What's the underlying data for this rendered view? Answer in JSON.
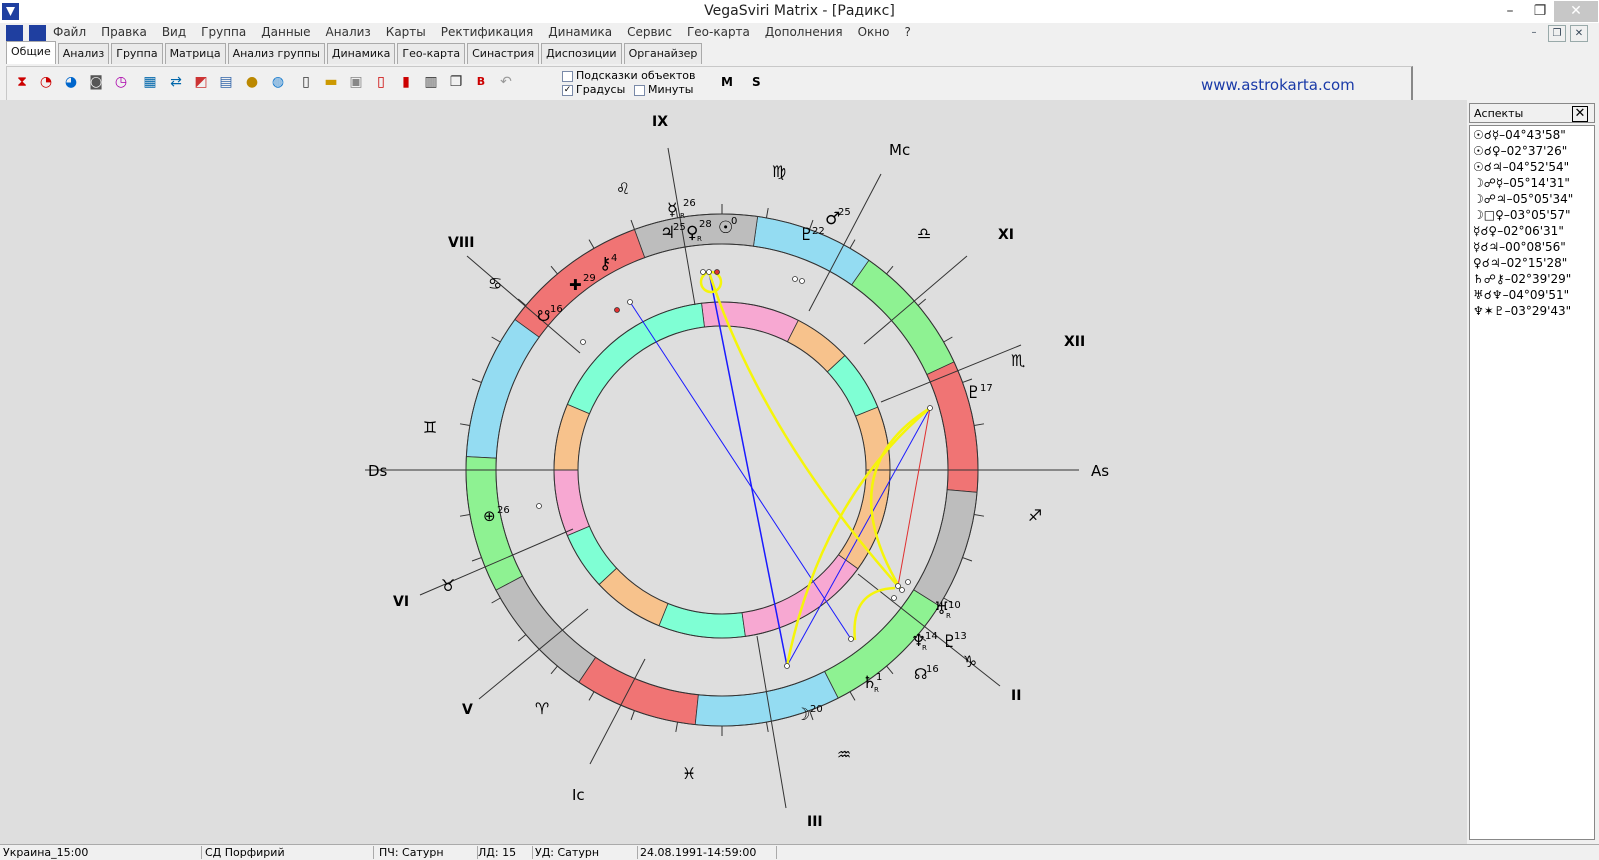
{
  "window": {
    "title": "VegaSviri Matrix - [Радикс]",
    "min_glyph": "–",
    "max_glyph": "❐",
    "close_glyph": "✕"
  },
  "menu": [
    "Файл",
    "Правка",
    "Вид",
    "Группа",
    "Данные",
    "Анализ",
    "Карты",
    "Ректификация",
    "Динамика",
    "Сервис",
    "Гео-карта",
    "Дополнения",
    "Окно",
    "?"
  ],
  "tabs": [
    "Общие",
    "Анализ",
    "Группа",
    "Матрица",
    "Анализ группы",
    "Динамика",
    "Гео-карта",
    "Синастрия",
    "Диспозиции",
    "Органайзер"
  ],
  "toolbar": {
    "hints_label": "Подсказки объектов",
    "degrees_label": "Градусы",
    "minutes_label": "Минуты",
    "m_label": "M",
    "s_label": "S",
    "website": "www.astrokarta.com"
  },
  "chart": {
    "angles": {
      "as": "As",
      "ds": "Ds",
      "mc": "Mc",
      "ic": "Ic"
    },
    "houses": {
      "II": "II",
      "III": "III",
      "V": "V",
      "VI": "VI",
      "VIII": "VIII",
      "IX": "IX",
      "XI": "XI",
      "XII": "XII"
    },
    "zodiac": {
      "aries": "♈",
      "taurus": "♉",
      "gemini": "♊",
      "cancer": "♋",
      "leo": "♌",
      "virgo": "♍",
      "libra": "♎",
      "scorpio": "♏",
      "sagittarius": "♐",
      "capricorn": "♑",
      "aquarius": "♒",
      "pisces": "♓"
    },
    "planets": {
      "mercury": {
        "glyph": "☿",
        "deg": "26",
        "r": "R"
      },
      "jupiter": {
        "glyph": "♃",
        "deg": "25"
      },
      "venus": {
        "glyph": "♀",
        "deg": "28",
        "r": "R"
      },
      "sun": {
        "glyph": "☉",
        "deg": "0"
      },
      "pluto2": {
        "glyph": "♇",
        "deg": "22"
      },
      "mars": {
        "glyph": "♂",
        "deg": "25"
      },
      "chiron": {
        "glyph": "⚷",
        "deg": "4"
      },
      "cross": {
        "glyph": "✚",
        "deg": "29"
      },
      "lilith": {
        "glyph": "☋",
        "deg": "16"
      },
      "pluto": {
        "glyph": "♇",
        "deg": "17"
      },
      "fortune": {
        "glyph": "⊕",
        "deg": "26"
      },
      "uranus": {
        "glyph": "♅",
        "deg": "10",
        "r": "R"
      },
      "neptune": {
        "glyph": "♆",
        "deg": "14",
        "r": "R"
      },
      "proserpina": {
        "glyph": "♇",
        "deg": "13"
      },
      "node": {
        "glyph": "☊",
        "deg": "16"
      },
      "saturn": {
        "glyph": "♄",
        "deg": "1",
        "r": "R"
      },
      "moon": {
        "glyph": "☽",
        "deg": "20"
      }
    }
  },
  "aspects_panel": {
    "title": "Аспекты",
    "close_glyph": "✕",
    "items": [
      "☉☌☿–04°43'58\"",
      "☉☌♀–02°37'26\"",
      "☉☌♃–04°52'54\"",
      "☽☍☿–05°14'31\"",
      "☽☍♃–05°05'34\"",
      "☽□♀–03°05'57\"",
      "☿☌♀–02°06'31\"",
      "☿☌♃–00°08'56\"",
      "♀☌♃–02°15'28\"",
      "♄☍⚷–02°39'29\"",
      "♅☌♆–04°09'51\"",
      "♆✶♇–03°29'43\""
    ]
  },
  "status": {
    "location": "Украина_15:00",
    "system": "СД Порфирий",
    "pch": "ПЧ: Сатурн",
    "ld": "ЛД: 15",
    "ud": "УД: Сатурн",
    "datetime": "24.08.1991-14:59:00"
  }
}
